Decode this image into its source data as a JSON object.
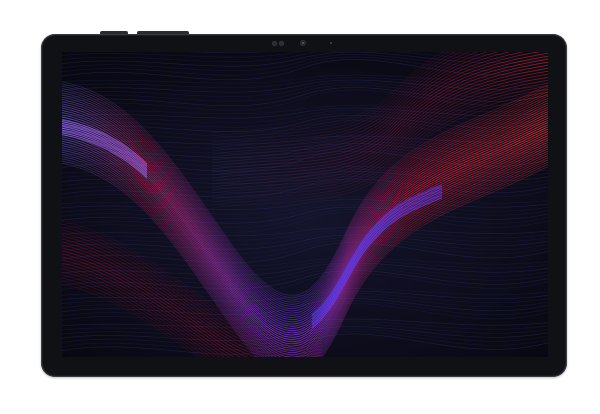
{
  "device": {
    "type": "tablet",
    "frame_color": "#1c1d21",
    "screen": {
      "wallpaper": "flowing-lines",
      "colors": {
        "background": "#0b0c1b",
        "red": "#e3152f",
        "crimson": "#b8102a",
        "purple": "#7b3cff",
        "blue": "#3f3bd6",
        "violet": "#a06bff"
      }
    }
  }
}
